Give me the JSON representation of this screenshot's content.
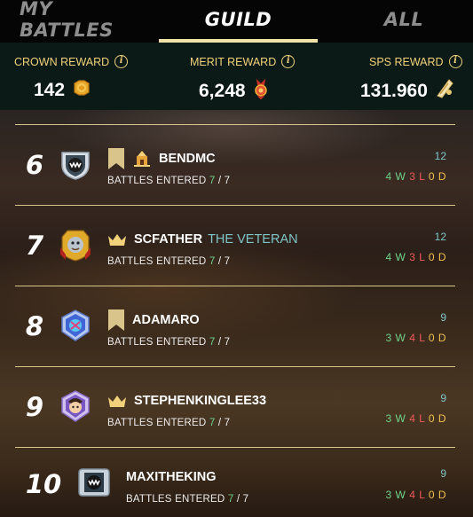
{
  "tabs": [
    {
      "label": "MY BATTLES",
      "active": false
    },
    {
      "label": "GUILD",
      "active": true
    },
    {
      "label": "ALL",
      "active": false
    }
  ],
  "rewards": {
    "crown": {
      "label": "CROWN REWARD",
      "value": "142",
      "icon": "crown-token-icon"
    },
    "merit": {
      "label": "MERIT REWARD",
      "value": "6,248",
      "icon": "merit-medal-icon"
    },
    "sps": {
      "label": "SPS REWARD",
      "value": "131.960",
      "icon": "sps-token-icon"
    }
  },
  "battles_label": "BATTLES ENTERED",
  "players": [
    {
      "rank": "6",
      "name": "BENDMC",
      "title": "",
      "entered": "7",
      "total": "7",
      "rating": "12",
      "w": "4 W",
      "l": "3 L",
      "d": "0 D",
      "badge": "bookmark",
      "extra": "guildhall"
    },
    {
      "rank": "7",
      "name": "SCFATHER",
      "title": "THE VETERAN",
      "entered": "7",
      "total": "7",
      "rating": "12",
      "w": "4 W",
      "l": "3 L",
      "d": "0 D",
      "badge": "crown"
    },
    {
      "rank": "8",
      "name": "ADAMARO",
      "title": "",
      "entered": "7",
      "total": "7",
      "rating": "9",
      "w": "3 W",
      "l": "4 L",
      "d": "0 D",
      "badge": "bookmark"
    },
    {
      "rank": "9",
      "name": "STEPHENKINGLEE33",
      "title": "",
      "entered": "7",
      "total": "7",
      "rating": "9",
      "w": "3 W",
      "l": "4 L",
      "d": "0 D",
      "badge": "crown"
    },
    {
      "rank": "10",
      "name": "MAXITHEKING",
      "title": "",
      "entered": "7",
      "total": "7",
      "rating": "9",
      "w": "3 W",
      "l": "4 L",
      "d": "0 D",
      "badge": ""
    }
  ],
  "colors": {
    "accent": "#f0e2a8",
    "gold": "#f1d27a",
    "teal": "#7ec6c7",
    "win": "#6fd38a",
    "loss": "#f05a58",
    "draw": "#f2c14e"
  }
}
